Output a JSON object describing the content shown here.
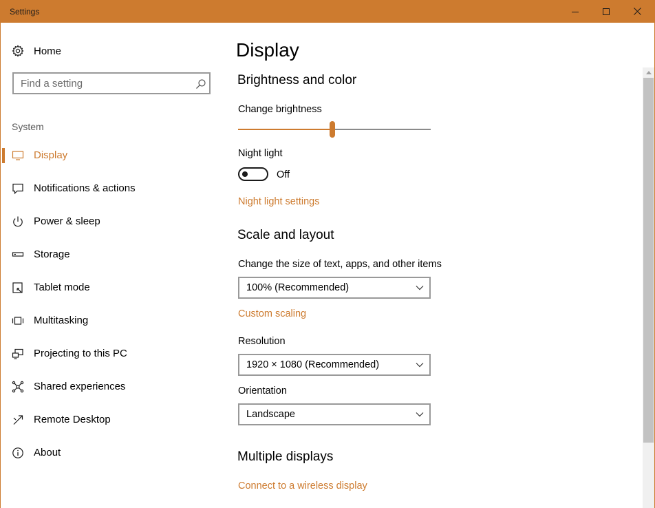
{
  "window": {
    "title": "Settings",
    "accent_color": "#cd7b2f"
  },
  "sidebar": {
    "home_label": "Home",
    "home_icon": "gear-icon",
    "search_placeholder": "Find a setting",
    "group_label": "System",
    "items": [
      {
        "label": "Display",
        "icon": "monitor-icon",
        "selected": true
      },
      {
        "label": "Notifications & actions",
        "icon": "message-icon",
        "selected": false
      },
      {
        "label": "Power & sleep",
        "icon": "power-icon",
        "selected": false
      },
      {
        "label": "Storage",
        "icon": "storage-icon",
        "selected": false
      },
      {
        "label": "Tablet mode",
        "icon": "tablet-icon",
        "selected": false
      },
      {
        "label": "Multitasking",
        "icon": "multitasking-icon",
        "selected": false
      },
      {
        "label": "Projecting to this PC",
        "icon": "projecting-icon",
        "selected": false
      },
      {
        "label": "Shared experiences",
        "icon": "shared-icon",
        "selected": false
      },
      {
        "label": "Remote Desktop",
        "icon": "remote-desktop-icon",
        "selected": false
      },
      {
        "label": "About",
        "icon": "info-icon",
        "selected": false
      }
    ]
  },
  "main": {
    "title": "Display",
    "brightness_color": {
      "heading": "Brightness and color",
      "brightness_label": "Change brightness",
      "brightness_level": 0.49,
      "night_light_label": "Night light",
      "night_light_state": "Off",
      "night_light_on": false,
      "night_light_settings_link": "Night light settings"
    },
    "scale_layout": {
      "heading": "Scale and layout",
      "scale_label": "Change the size of text, apps, and other items",
      "scale_value": "100% (Recommended)",
      "custom_scaling_link": "Custom scaling",
      "resolution_label": "Resolution",
      "resolution_value": "1920 × 1080 (Recommended)",
      "orientation_label": "Orientation",
      "orientation_value": "Landscape"
    },
    "multiple_displays": {
      "heading": "Multiple displays",
      "wireless_link": "Connect to a wireless display"
    }
  }
}
